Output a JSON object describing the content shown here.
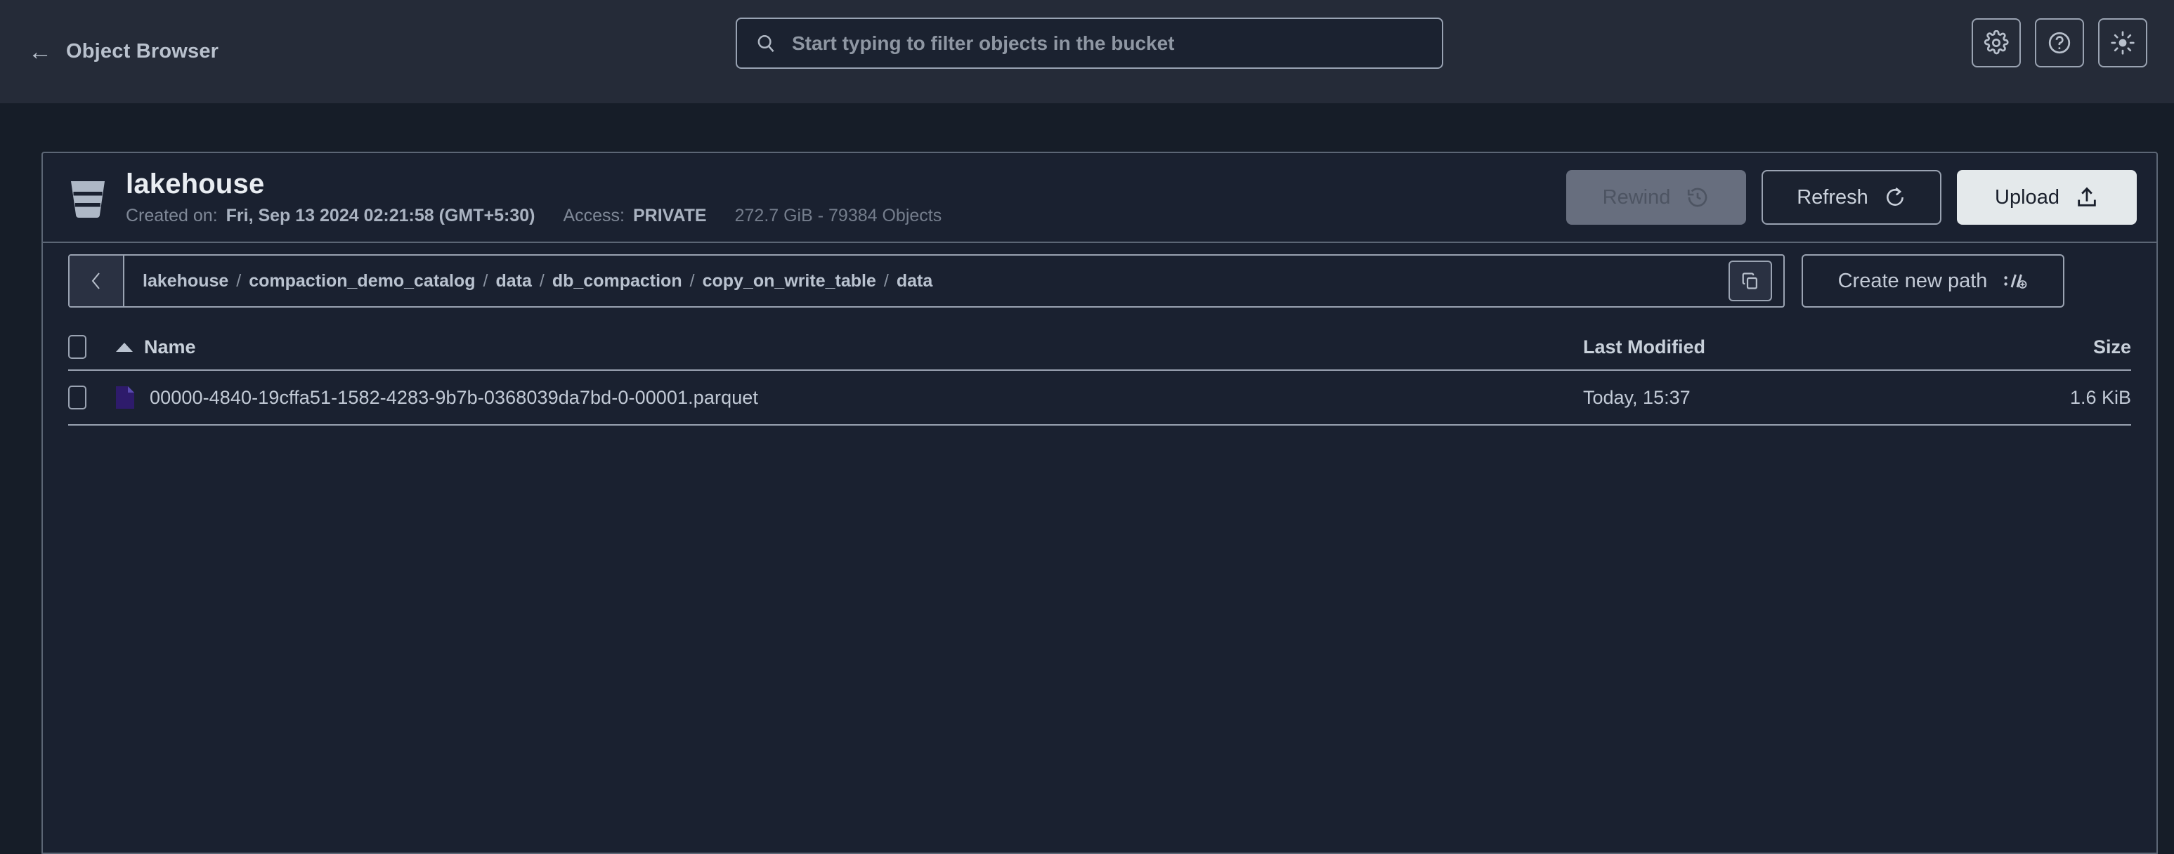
{
  "header": {
    "back_label": "Object Browser",
    "back_icon": "arrow-left-icon",
    "search": {
      "icon": "search-icon",
      "placeholder": "Start typing to filter objects in the bucket",
      "value": ""
    },
    "actions": [
      {
        "name": "settings-button",
        "icon": "gear-icon"
      },
      {
        "name": "help-button",
        "icon": "help-circle-icon"
      },
      {
        "name": "theme-toggle-button",
        "icon": "sun-icon"
      }
    ]
  },
  "bucket": {
    "icon": "bucket-icon",
    "name": "lakehouse",
    "created_label": "Created on:",
    "created_value": "Fri, Sep 13 2024 02:21:58 (GMT+5:30)",
    "access_label": "Access:",
    "access_value": "PRIVATE",
    "stats": "272.7 GiB - 79384 Objects",
    "actions": {
      "rewind_label": "Rewind",
      "rewind_icon": "rewind-clock-icon",
      "rewind_disabled": "true",
      "refresh_label": "Refresh",
      "refresh_icon": "refresh-icon",
      "upload_label": "Upload",
      "upload_icon": "upload-icon"
    }
  },
  "path": {
    "back_icon": "chevron-left-icon",
    "copy_icon": "copy-icon",
    "crumbs": [
      "lakehouse",
      "compaction_demo_catalog",
      "data",
      "db_compaction",
      "copy_on_write_table",
      "data"
    ],
    "separator": "/",
    "create_path_label": "Create new path",
    "create_path_icon": "path-add-icon"
  },
  "table": {
    "columns": {
      "name": "Name",
      "last_modified": "Last Modified",
      "size": "Size"
    },
    "sort": {
      "column": "Name",
      "direction": "asc",
      "icon": "sort-asc-icon"
    },
    "rows": [
      {
        "icon": "parquet-file-icon",
        "name": "00000-4840-19cffa51-1582-4283-9b7b-0368039da7bd-0-00001.parquet",
        "last_modified": "Today, 15:37",
        "size": "1.6 KiB"
      }
    ]
  },
  "colors": {
    "page_bg": "#161d28",
    "topbar_bg": "#252b38",
    "panel_bg": "#1a2130",
    "border": "#9aa3b2",
    "text_primary": "#c8d0da",
    "text_muted": "#7f8897",
    "upload_bg": "#e4e9eb",
    "rewind_bg": "#676e7e",
    "file_icon": "#2e1b6b"
  }
}
